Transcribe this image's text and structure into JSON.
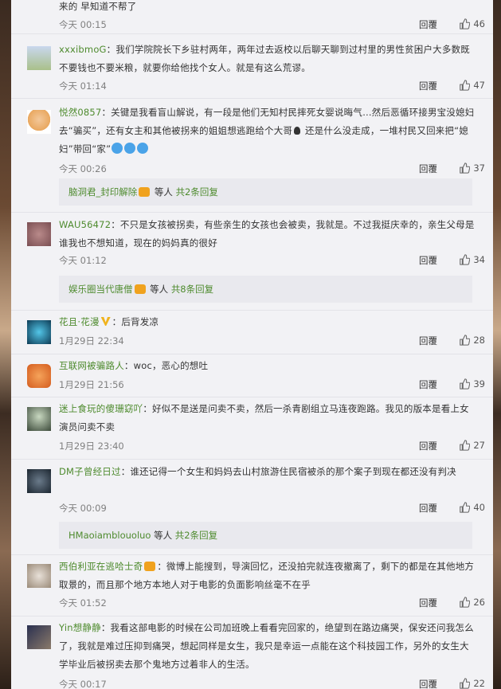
{
  "top_fragment": {
    "text": "来的 早知道不帮了",
    "time": "今天 00:15",
    "reply": "回覆",
    "likes": "46"
  },
  "comments": [
    {
      "user": "xxxibmoG",
      "text": "：我们学院院长下乡驻村两年，两年过去返校以后聊天聊到过村里的男性贫困户大多数既不要钱也不要米粮，就要你给他找个女人。就是有这么荒谬。",
      "time": "今天 01:14",
      "reply": "回覆",
      "likes": "47"
    },
    {
      "user": "悦然0857",
      "text_a": "：关键是我看盲山解说，有一段是他们无知村民摔死女婴说晦气…然后恶循环接男宝没媳妇去“骗买”，还有女主和其他被拐来的姐姐想逃跑给个大哥",
      "text_b": "还是什么没走成，一堆村民又回来把“媳妇”带回“家”",
      "time": "今天 00:26",
      "reply": "回覆",
      "likes": "37",
      "sub": {
        "names": "脑洞君_封印解除",
        "suffix": " 等人 ",
        "count": "共2条回复"
      }
    },
    {
      "user": "WAU56472",
      "text": "：不只是女孩被拐卖，有些亲生的女孩也会被卖，我就是。不过我挺庆幸的，亲生父母是谁我也不想知道，现在的妈妈真的很好",
      "time": "今天 01:12",
      "reply": "回覆",
      "likes": "34",
      "sub": {
        "names": "娱乐圈当代唐僧",
        "suffix": " 等人 ",
        "count": "共8条回复"
      }
    },
    {
      "user": "花且·花漫",
      "text": "：后背发凉",
      "time": "1月29日 22:34",
      "reply": "回覆",
      "likes": "28"
    },
    {
      "user": "互联网被骗路人",
      "text": "：woc，恶心的想吐",
      "time": "1月29日 21:56",
      "reply": "回覆",
      "likes": "39"
    },
    {
      "user": "迷上食玩的傻珊窈吖",
      "text": "：好似不是送是问卖不卖，然后一杀青剧组立马连夜跑路。我见的版本是看上女演员问卖不卖",
      "time": "1月29日 23:40",
      "reply": "回覆",
      "likes": "27"
    },
    {
      "user": "DM子曾经日过",
      "text": "：谁还记得一个女生和妈妈去山村旅游住民宿被杀的那个案子到现在都还没有判决",
      "time": "今天 00:09",
      "reply": "回覆",
      "likes": "40",
      "sub": {
        "names": "HMaoiamblouoluo",
        "suffix": " 等人 ",
        "count": "共2条回复"
      }
    },
    {
      "user": "西伯利亚在逃哈士奇",
      "text": "：微博上能搜到，导演回忆，还没拍完就连夜撤离了，剩下的都是在其他地方取景的，而且那个地方本地人对于电影的负面影响丝毫不在乎",
      "time": "今天 01:52",
      "reply": "回覆",
      "likes": "26"
    },
    {
      "user": "Yin想静静",
      "text": "：我看这部电影的时候在公司加班晚上看看完回家的，绝望到在路边痛哭，保安还问我怎么了，我就是难过压抑到痛哭，想起同样是女生，我只是幸运一点能在这个科技园工作，另外的女生大学毕业后被拐卖去那个鬼地方过着非人的生活。",
      "time": "今天 00:17",
      "reply": "回覆",
      "likes": "22"
    }
  ],
  "colors": {
    "username": "#eb7350",
    "link": "#4e8b2e",
    "panel": "#f2f2f5"
  }
}
